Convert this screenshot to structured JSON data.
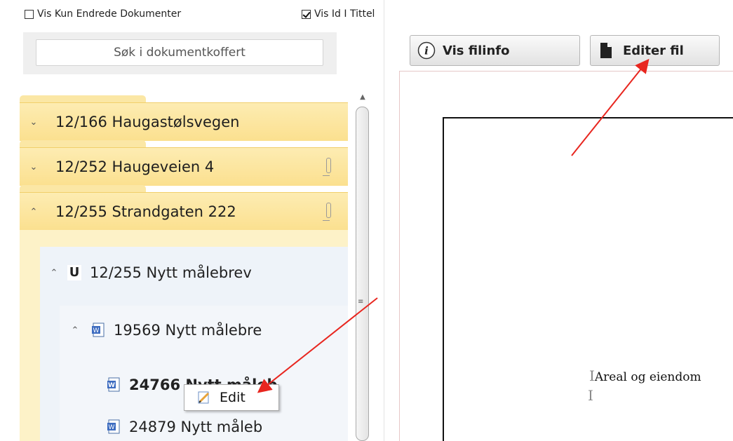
{
  "options": {
    "show_changed_label": "Vis Kun Endrede Dokumenter",
    "show_changed_checked": false,
    "show_id_label": "Vis Id I Tittel",
    "show_id_checked": true
  },
  "search": {
    "placeholder": "Søk i dokumentkoffert"
  },
  "folders": [
    {
      "label": "12/166  Haugastølsvegen",
      "expanded": false,
      "has_attachment": false
    },
    {
      "label": "12/252  Haugeveien 4",
      "expanded": false,
      "has_attachment": true
    },
    {
      "label": "12/255  Strandgaten 222",
      "expanded": true,
      "has_attachment": true
    }
  ],
  "case": {
    "badge": "U",
    "label": "12/255 Nytt målebrev"
  },
  "document": {
    "label": "19569 Nytt målebre"
  },
  "files": [
    {
      "label": "24766 Nytt måleb",
      "bold": true
    },
    {
      "label": "24879 Nytt måleb",
      "bold": false
    }
  ],
  "context_menu": {
    "edit_label": "Edit"
  },
  "toolbar": {
    "fileinfo_label": "Vis filinfo",
    "edit_file_label": "Editer fil"
  },
  "preview": {
    "text": "Areal og eiendom"
  },
  "icons": {
    "info": "info-icon",
    "file": "file-icon",
    "word": "word-document-icon",
    "pencil": "pencil-icon",
    "chevron_down": "chevron-down-icon",
    "chevron_up": "chevron-up-icon",
    "paperclip": "paperclip-icon"
  },
  "colors": {
    "folder": "#fbe08f",
    "annotation_arrow": "#e8261f"
  }
}
